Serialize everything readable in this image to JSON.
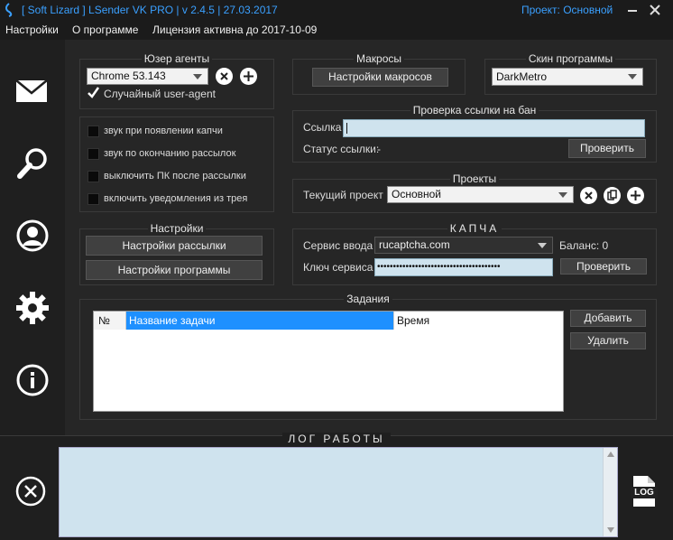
{
  "window": {
    "title": "[ Soft Lizard ] LSender VK PRO | v 2.4.5 | 27.03.2017",
    "project_label": "Проект: Основной"
  },
  "menu": {
    "settings": "Настройки",
    "about": "О программе",
    "license": "Лицензия активна до 2017-10-09"
  },
  "sidebar": {
    "icons": [
      "mail-icon",
      "search-icon",
      "user-icon",
      "gear-icon",
      "info-icon"
    ]
  },
  "user_agents": {
    "title": "Юзер агенты",
    "selected": "Chrome 53.143",
    "random_label": "Случайный user-agent",
    "random_checked": true
  },
  "options": [
    {
      "label": "звук при появлении капчи",
      "checked": false
    },
    {
      "label": "звук по окончанию рассылок",
      "checked": false
    },
    {
      "label": "выключить ПК после рассылки",
      "checked": false
    },
    {
      "label": "включить уведомления из трея",
      "checked": false
    }
  ],
  "settings_group": {
    "title": "Настройки",
    "mailing_button": "Настройки рассылки",
    "program_button": "Настройки программы"
  },
  "macros": {
    "title": "Макросы",
    "button": "Настройки макросов"
  },
  "skin": {
    "title": "Скин программы",
    "selected": "DarkMetro"
  },
  "ban_check": {
    "title": "Проверка ссылки на бан",
    "link_label": "Ссылка",
    "link_value": "",
    "status_label": "Статус ссылки:",
    "status_value": "-",
    "check_button": "Проверить"
  },
  "projects": {
    "title": "Проекты",
    "current_label": "Текущий проект",
    "selected": "Основной"
  },
  "captcha": {
    "title": "КАПЧА",
    "service_label": "Сервис ввода",
    "service_selected": "rucaptcha.com",
    "balance_label": "Баланс: 0",
    "key_label": "Ключ сервиса",
    "key_value": "•••••••••••••••••••••••••••••••••••••••",
    "check_button": "Проверить"
  },
  "tasks": {
    "title": "Задания",
    "columns": [
      "№",
      "Название задачи",
      "Время"
    ],
    "rows": [],
    "add_button": "Добавить",
    "delete_button": "Удалить"
  },
  "log": {
    "title": "ЛОГ РАБОТЫ",
    "log_button_text": "LOG"
  },
  "colors": {
    "accent": "#1e90ff",
    "title_text": "#3aa0ff",
    "bg": "#262626"
  }
}
